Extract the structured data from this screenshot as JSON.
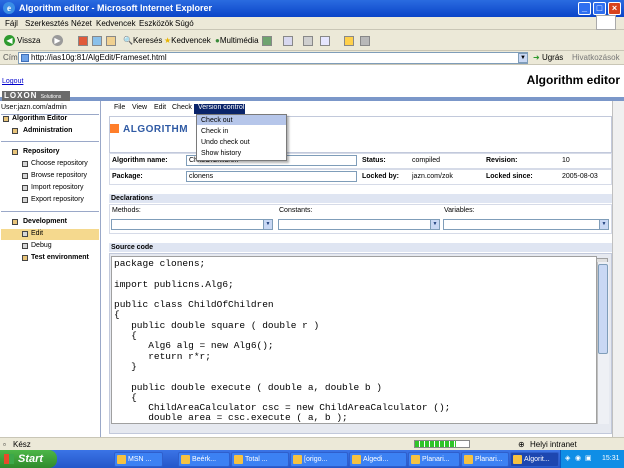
{
  "window": {
    "title": "Algorithm editor - Microsoft Internet Explorer"
  },
  "ie_menu": [
    "Fájl",
    "Szerkesztés",
    "Nézet",
    "Kedvencek",
    "Eszközök",
    "Súgó"
  ],
  "toolbar": {
    "back": "Vissza",
    "search": "Keresés",
    "favorites": "Kedvencek",
    "media": "Multimédia"
  },
  "address": {
    "label": "Cím",
    "url": "http://ias10g:81/AlgEdit/Frameset.html",
    "go": "Ugrás",
    "links": "Hivatkozások"
  },
  "app": {
    "logout": "Logout",
    "title": "Algorithm editor",
    "logo": "LOXON",
    "logo_sub": "Solutions",
    "user": "User:jazn.com/admin"
  },
  "sidebar": {
    "algorithm_editor": "Algorithm Editor",
    "administration": "Administration",
    "repository": "Repository",
    "repo_items": [
      "Choose repository",
      "Browse repository",
      "Import repository",
      "Export repository"
    ],
    "development": "Development",
    "dev_items": [
      "Edit",
      "Debug"
    ],
    "test_env": "Test environment"
  },
  "app_menu": [
    "File",
    "View",
    "Edit",
    "Check",
    "Version control"
  ],
  "vc_menu": [
    "Check out",
    "Check in",
    "Undo check out",
    "Show history"
  ],
  "algorithm": {
    "heading": "ALGORITHM",
    "name_label": "Algorithm name:",
    "name_value": "ChildOfChildren",
    "package_label": "Package:",
    "package_value": "clonens",
    "status_label": "Status:",
    "status_value": "compiled",
    "revision_label": "Revision:",
    "revision_value": "10",
    "lockedby_label": "Locked by:",
    "lockedby_value": "jazn.com/zok",
    "lockedsince_label": "Locked since:",
    "lockedsince_value": "2005-08-03"
  },
  "declarations": {
    "heading": "Declarations",
    "methods": "Methods:",
    "constants": "Constants:",
    "variables": "Variables:"
  },
  "source": {
    "heading": "Source code",
    "code": "package clonens;\n\nimport publicns.Alg6;\n\npublic class ChildOfChildren\n{\n   public double square ( double r )\n   {\n      Alg6 alg = new Alg6();\n      return r*r;\n   }\n\n   public double execute ( double a, double b )\n   {\n      ChildAreaCalculator csc = new ChildAreaCalculator ();\n      double area = csc.execute ( a, b );"
  },
  "status": {
    "text": "Kész",
    "zone": "Helyi intranet",
    "progress": 0.75
  },
  "taskbar": {
    "start": "Start",
    "items": [
      "MSN ...",
      "Beérk...",
      "Total ...",
      "[origo...",
      "Algedi...",
      "Planari...",
      "Planari...",
      "Algorit..."
    ],
    "clock": "15:31"
  }
}
